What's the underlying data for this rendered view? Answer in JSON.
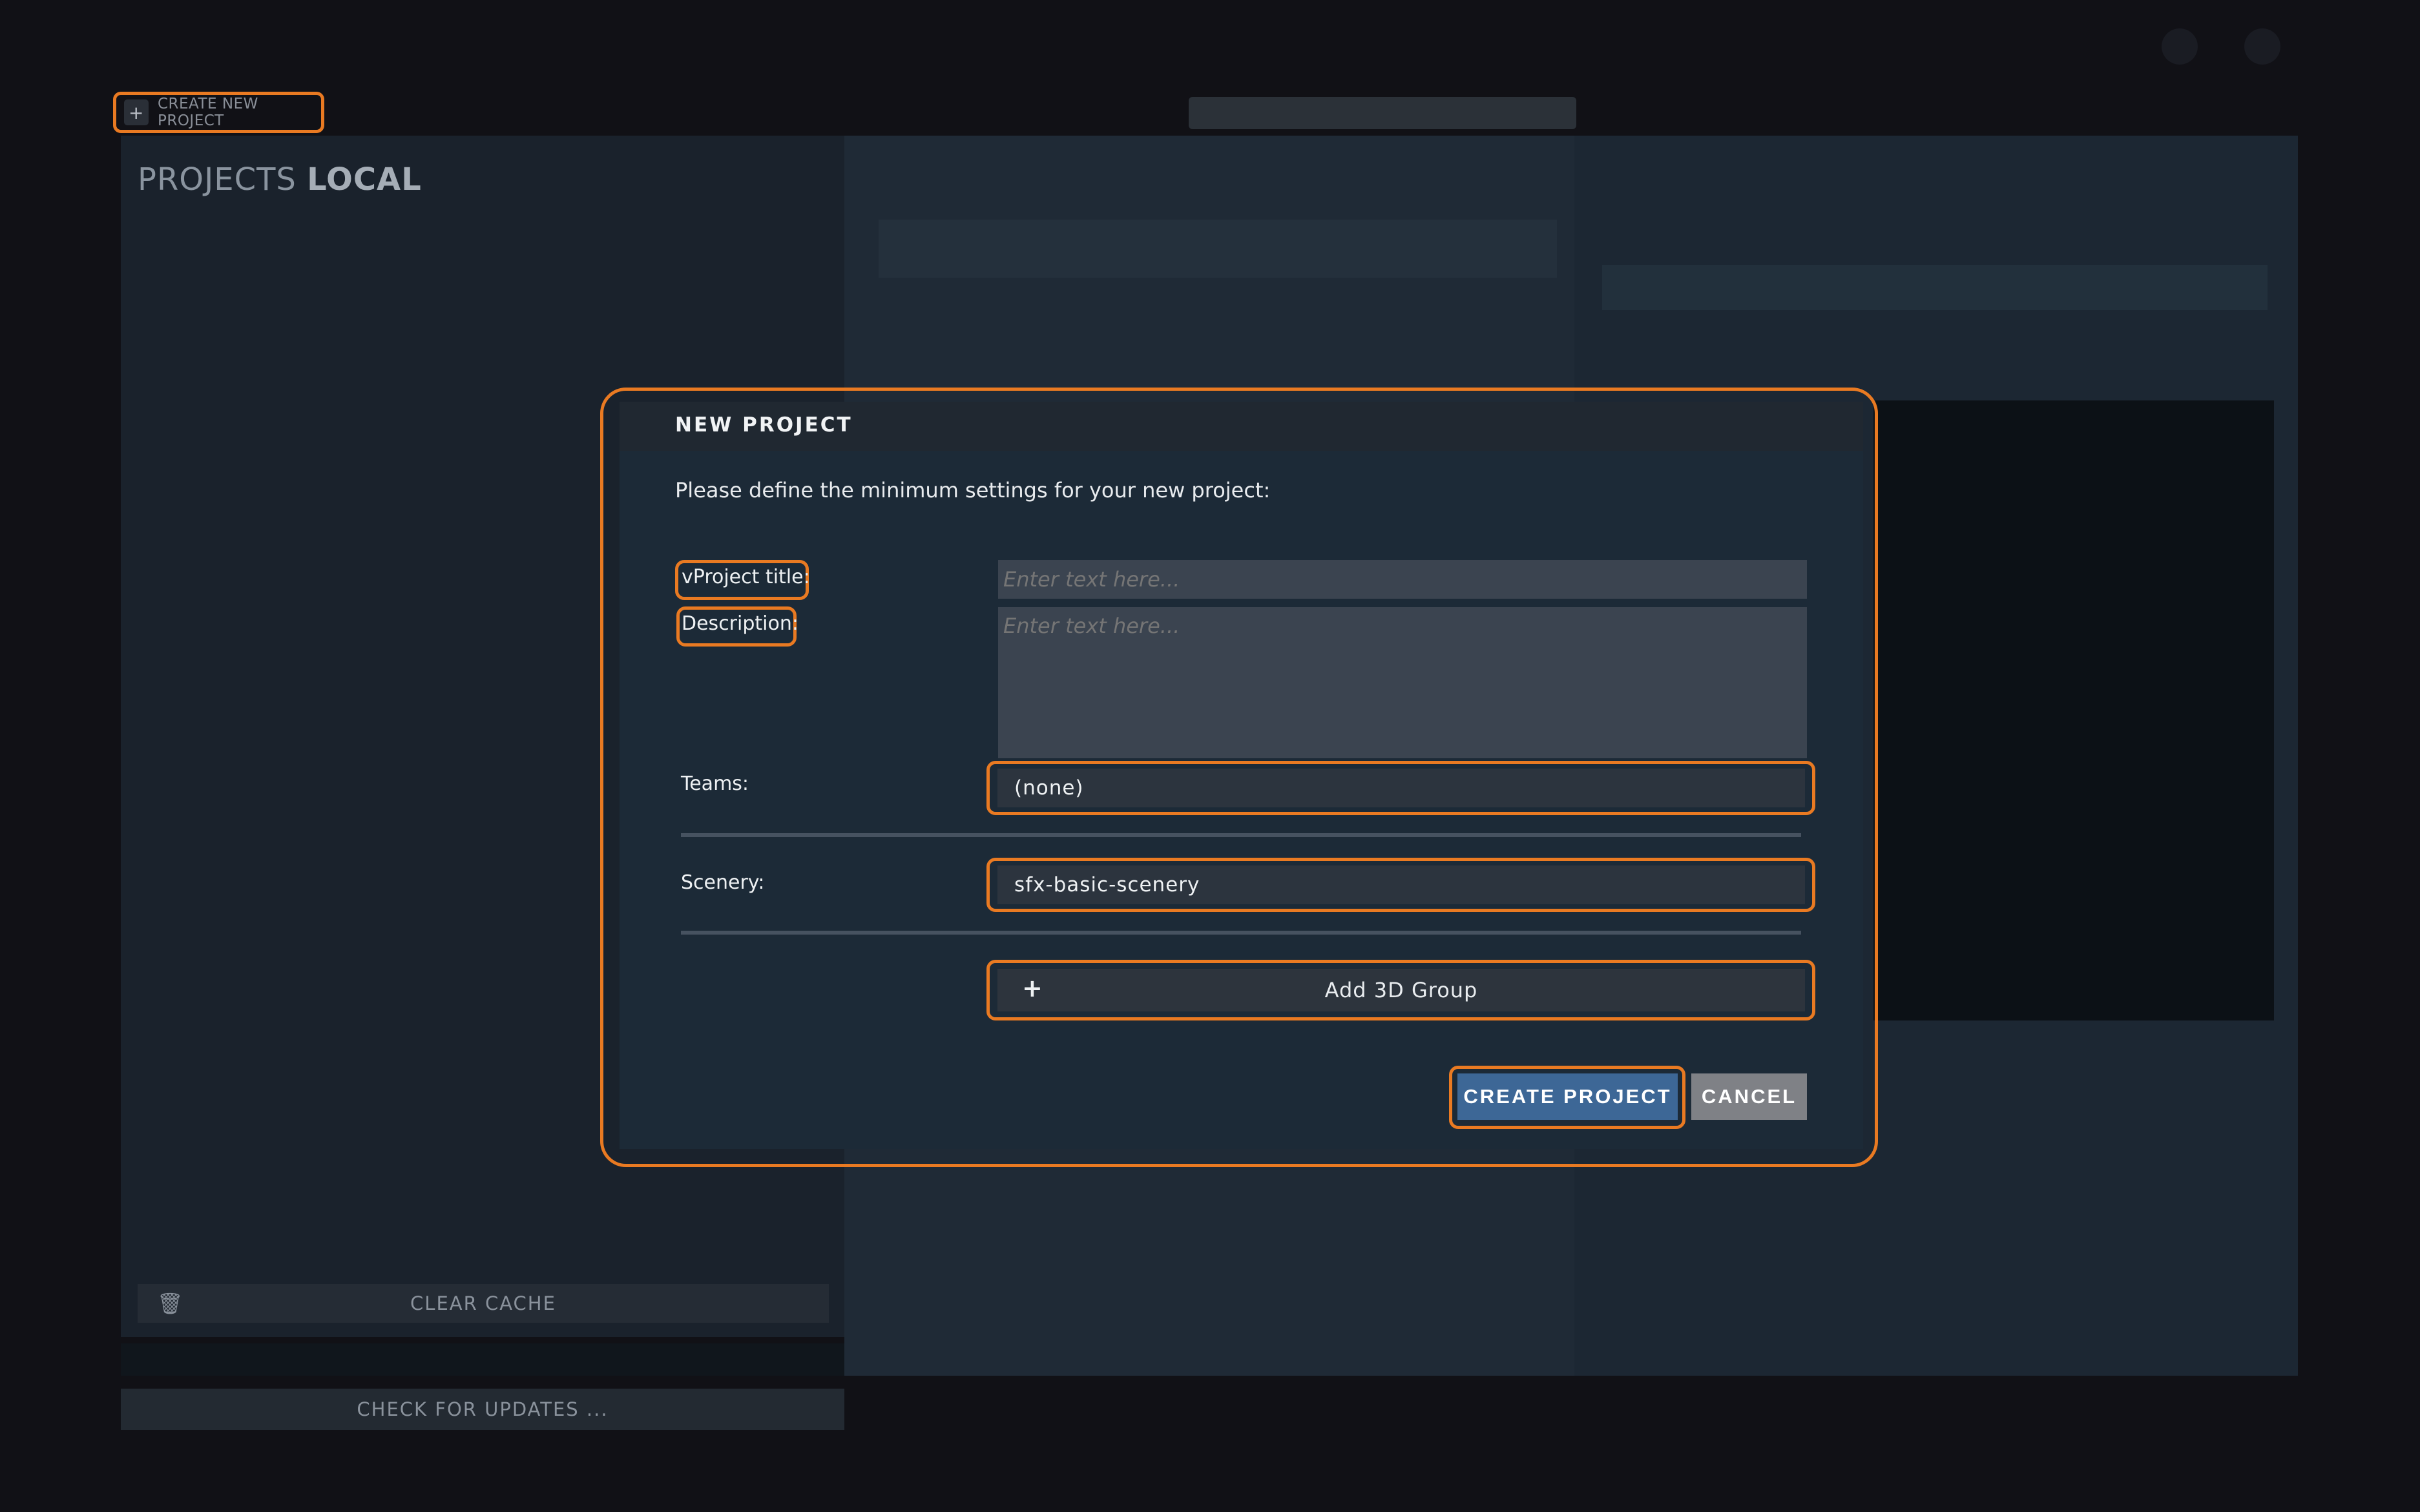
{
  "toolbar": {
    "create_new_project_label": "CREATE NEW PROJECT",
    "plus_icon_glyph": "+"
  },
  "local_panel": {
    "title_prefix": "PROJECTS",
    "title_bold": "LOCAL",
    "clear_cache_label": "CLEAR CACHE",
    "trash_icon_glyph": "🗑",
    "check_updates_label": "CHECK FOR UPDATES ..."
  },
  "modal": {
    "title": "NEW PROJECT",
    "intro": "Please define the minimum settings for your new project:",
    "fields": {
      "title_label": "vProject title:",
      "title_placeholder": "Enter text here...",
      "description_label": "Description:",
      "description_placeholder": "Enter text here...",
      "teams_label": "Teams:",
      "teams_value": "(none)",
      "scenery_label": "Scenery:",
      "scenery_value": "sfx-basic-scenery"
    },
    "add_group_label": "Add 3D Group",
    "add_group_plus": "+",
    "create_button": "CREATE PROJECT",
    "cancel_button": "CANCEL"
  },
  "colors": {
    "highlight": "#e97a22",
    "primary_button": "#3d6796",
    "cancel_button": "#7f8186",
    "modal_background": "#1c2a37"
  }
}
